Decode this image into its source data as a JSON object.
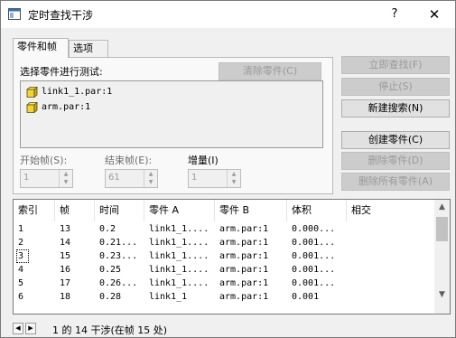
{
  "window": {
    "title": "定时查找干涉",
    "help": "?",
    "close": "✕"
  },
  "tabs": [
    {
      "label": "零件和帧",
      "active": true
    },
    {
      "label": "选项",
      "active": false
    }
  ],
  "parts_panel": {
    "label": "选择零件进行测试:",
    "clear_button": "清除零件(C)",
    "items": [
      "link1_1.par:1",
      "arm.par:1"
    ]
  },
  "frames": {
    "start_label": "开始帧(S):",
    "start_value": "1",
    "end_label": "结束帧(E):",
    "end_value": "61",
    "step_label": "增量(I)",
    "step_value": "1"
  },
  "actions": {
    "find_now": "立即查找(F)",
    "stop": "停止(S)",
    "new_search": "新建搜索(N)",
    "create_part": "创建零件(C)",
    "delete_part": "删除零件(D)",
    "delete_all": "删除所有零件(A)"
  },
  "results": {
    "columns": [
      "索引",
      "帧",
      "时间",
      "零件 A",
      "零件 B",
      "体积",
      "相交"
    ],
    "rows": [
      [
        "1",
        "13",
        "0.2",
        "link1_1....",
        "arm.par:1",
        "0.000...",
        ""
      ],
      [
        "2",
        "14",
        "0.21...",
        "link1_1....",
        "arm.par:1",
        "0.001...",
        ""
      ],
      [
        "3",
        "15",
        "0.23...",
        "link1_1....",
        "arm.par:1",
        "0.001...",
        ""
      ],
      [
        "4",
        "16",
        "0.25",
        "link1_1....",
        "arm.par:1",
        "0.001...",
        ""
      ],
      [
        "5",
        "17",
        "0.26...",
        "link1_1....",
        "arm.par:1",
        "0.001...",
        ""
      ],
      [
        "6",
        "18",
        "0.28",
        "link1_1",
        "arm.par:1",
        "0.001",
        ""
      ]
    ],
    "focused_row": 2
  },
  "status": {
    "text": "1 的 14 干涉(在帧 15 处)"
  },
  "colors": {
    "part_icon": "#f2d33a",
    "disabled_text": "#9a9a9a"
  }
}
